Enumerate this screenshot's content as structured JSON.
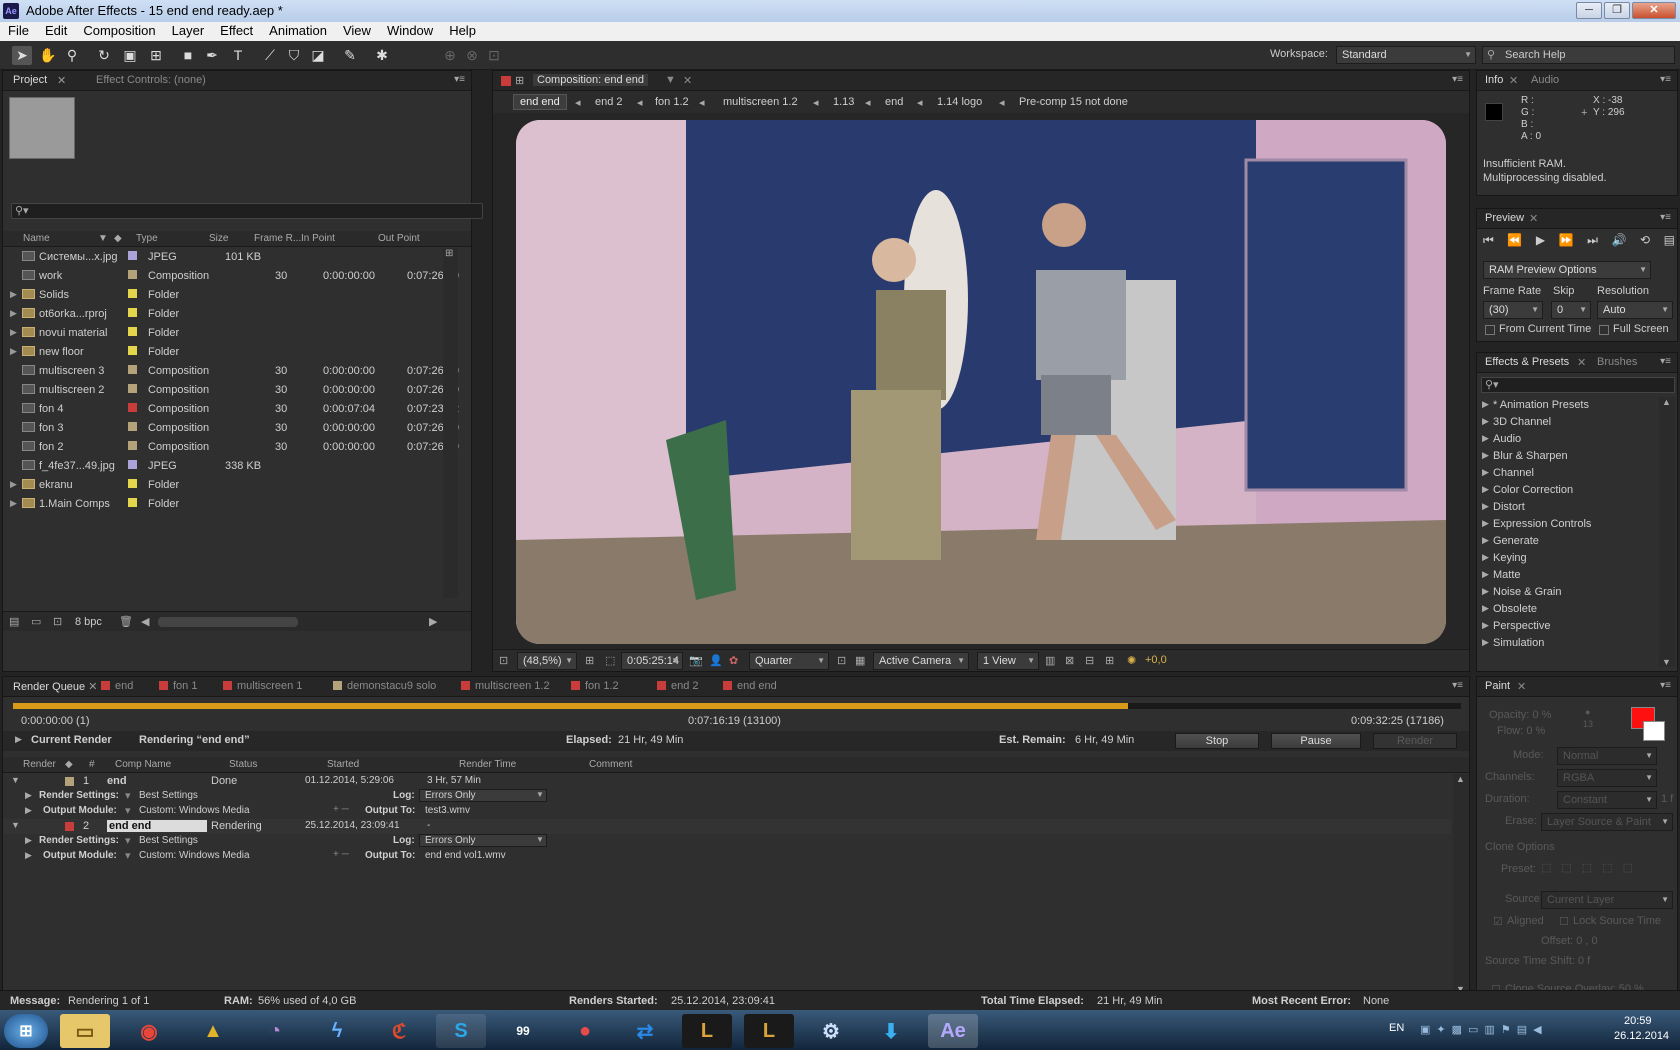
{
  "window": {
    "title": "Adobe After Effects - 15 end end ready.aep *",
    "app_icon": "Ae",
    "min": "─",
    "max": "❐",
    "close": "✕"
  },
  "menu": [
    "File",
    "Edit",
    "Composition",
    "Layer",
    "Effect",
    "Animation",
    "View",
    "Window",
    "Help"
  ],
  "toolbar": {
    "workspace_label": "Workspace:",
    "workspace_value": "Standard",
    "search_help": "Search Help"
  },
  "project": {
    "tabs": [
      "Project",
      "Effect Controls: (none)"
    ],
    "search_placeholder": "",
    "columns": [
      "Name",
      "Type",
      "Size",
      "Frame R...",
      "In Point",
      "Out Point"
    ],
    "items": [
      {
        "name": "Системы...x.jpg",
        "type": "JPEG",
        "size": "101 KB",
        "fr": "",
        "in": "",
        "out": "",
        "color": "#a9a3d9",
        "icon": "image-icon",
        "expand": false
      },
      {
        "name": "work",
        "type": "Composition",
        "size": "",
        "fr": "30",
        "in": "0:00:00:00",
        "out": "0:07:26:19",
        "color": "#b3a27a",
        "icon": "composition-icon",
        "expand": false
      },
      {
        "name": "Solids",
        "type": "Folder",
        "size": "",
        "fr": "",
        "in": "",
        "out": "",
        "color": "#e3d54c",
        "icon": "folder-icon",
        "expand": true
      },
      {
        "name": "ot6orka...rproj",
        "type": "Folder",
        "size": "",
        "fr": "",
        "in": "",
        "out": "",
        "color": "#e3d54c",
        "icon": "folder-icon",
        "expand": true
      },
      {
        "name": "novui material",
        "type": "Folder",
        "size": "",
        "fr": "",
        "in": "",
        "out": "",
        "color": "#e3d54c",
        "icon": "folder-icon",
        "expand": true
      },
      {
        "name": "new floor",
        "type": "Folder",
        "size": "",
        "fr": "",
        "in": "",
        "out": "",
        "color": "#e3d54c",
        "icon": "folder-icon",
        "expand": true
      },
      {
        "name": "multiscreen 3",
        "type": "Composition",
        "size": "",
        "fr": "30",
        "in": "0:00:00:00",
        "out": "0:07:26:19",
        "color": "#b3a27a",
        "icon": "composition-icon",
        "expand": false
      },
      {
        "name": "multiscreen 2",
        "type": "Composition",
        "size": "",
        "fr": "30",
        "in": "0:00:00:00",
        "out": "0:07:26:19",
        "color": "#b3a27a",
        "icon": "composition-icon",
        "expand": false
      },
      {
        "name": "fon 4",
        "type": "Composition",
        "size": "",
        "fr": "30",
        "in": "0:00:07:04",
        "out": "0:07:23:22",
        "color": "#c83c3c",
        "icon": "composition-icon",
        "expand": false
      },
      {
        "name": "fon 3",
        "type": "Composition",
        "size": "",
        "fr": "30",
        "in": "0:00:00:00",
        "out": "0:07:26:19",
        "color": "#b3a27a",
        "icon": "composition-icon",
        "expand": false
      },
      {
        "name": "fon 2",
        "type": "Composition",
        "size": "",
        "fr": "30",
        "in": "0:00:00:00",
        "out": "0:07:26:19",
        "color": "#b3a27a",
        "icon": "composition-icon",
        "expand": false
      },
      {
        "name": "f_4fe37...49.jpg",
        "type": "JPEG",
        "size": "338 KB",
        "fr": "",
        "in": "",
        "out": "",
        "color": "#a9a3d9",
        "icon": "image-icon",
        "expand": false
      },
      {
        "name": "ekranu",
        "type": "Folder",
        "size": "",
        "fr": "",
        "in": "",
        "out": "",
        "color": "#e3d54c",
        "icon": "folder-icon",
        "expand": true
      },
      {
        "name": "1.Main Comps",
        "type": "Folder",
        "size": "",
        "fr": "",
        "in": "",
        "out": "",
        "color": "#e3d54c",
        "icon": "folder-icon",
        "expand": true
      }
    ],
    "bpc": "8 bpc"
  },
  "composition": {
    "tab": "Composition: end end",
    "breadcrumbs": [
      "end end",
      "end 2",
      "fon 1.2",
      "multiscreen 1.2",
      "1.13",
      "end",
      "1.14 logo",
      "Pre-comp 15 not done"
    ],
    "zoom": "(48,5%)",
    "timecode": "0:05:25:14",
    "resolution": "Quarter",
    "camera": "Active Camera",
    "view": "1 View",
    "exposure": "+0,0"
  },
  "info": {
    "tabs": [
      "Info",
      "Audio"
    ],
    "r": "R :",
    "g": "G :",
    "b": "B :",
    "a": "A : 0",
    "x": "X : -38",
    "y": "Y : 296",
    "message": "Insufficient RAM.\nMultiprocessing disabled."
  },
  "preview": {
    "tab": "Preview",
    "ram_options": "RAM Preview Options",
    "frame_rate_label": "Frame Rate",
    "skip_label": "Skip",
    "resolution_label": "Resolution",
    "frame_rate": "(30)",
    "skip": "0",
    "resolution": "Auto",
    "from_current": "From Current Time",
    "full_screen": "Full Screen"
  },
  "effects": {
    "tabs": [
      "Effects & Presets",
      "Brushes"
    ],
    "items": [
      "* Animation Presets",
      "3D Channel",
      "Audio",
      "Blur & Sharpen",
      "Channel",
      "Color Correction",
      "Distort",
      "Expression Controls",
      "Generate",
      "Keying",
      "Matte",
      "Noise & Grain",
      "Obsolete",
      "Perspective",
      "Simulation"
    ]
  },
  "render": {
    "tabs": [
      {
        "label": "Render Queue",
        "color": ""
      },
      {
        "label": "end",
        "color": "#c83c3c"
      },
      {
        "label": "fon 1",
        "color": "#c83c3c"
      },
      {
        "label": "multiscreen 1",
        "color": "#c83c3c"
      },
      {
        "label": "demonstacu9 solo",
        "color": "#b3a27a"
      },
      {
        "label": "multiscreen 1.2",
        "color": "#c83c3c"
      },
      {
        "label": "fon 1.2",
        "color": "#c83c3c"
      },
      {
        "label": "end 2",
        "color": "#c83c3c"
      },
      {
        "label": "end end",
        "color": "#c83c3c"
      }
    ],
    "time_start": "0:00:00:00 (1)",
    "time_mid": "0:07:16:19 (13100)",
    "time_end": "0:09:32:25 (17186)",
    "progress": 0.77,
    "current_render_label": "Current Render",
    "rendering_text": "Rendering “end end”",
    "elapsed_label": "Elapsed:",
    "elapsed": "21 Hr, 49 Min",
    "remain_label": "Est. Remain:",
    "remain": "6 Hr, 49 Min",
    "stop": "Stop",
    "pause": "Pause",
    "render_btn": "Render",
    "columns": [
      "Render",
      "#",
      "Comp Name",
      "Status",
      "Started",
      "Render Time",
      "Comment"
    ],
    "items": [
      {
        "num": "1",
        "comp": "end",
        "status": "Done",
        "started": "01.12.2014, 5:29:06",
        "time": "3 Hr, 57 Min",
        "color": "#b3a27a",
        "settings": "Best Settings",
        "log": "Errors Only",
        "module": "Custom: Windows Media",
        "output": "test3.wmv"
      },
      {
        "num": "2",
        "comp": "end end",
        "status": "Rendering",
        "started": "25.12.2014, 23:09:41",
        "time": "-",
        "color": "#c83c3c",
        "settings": "Best Settings",
        "log": "Errors Only",
        "module": "Custom: Windows Media",
        "output": "end end vol1.wmv"
      }
    ],
    "settings_label": "Render Settings:",
    "log_label": "Log:",
    "module_label": "Output Module:",
    "output_label": "Output To:"
  },
  "status": {
    "message_label": "Message:",
    "message": "Rendering 1 of 1",
    "ram_label": "RAM:",
    "ram": "56% used of 4,0 GB",
    "started_label": "Renders Started:",
    "started": "25.12.2014, 23:09:41",
    "total_label": "Total Time Elapsed:",
    "total": "21 Hr, 49 Min",
    "error_label": "Most Recent Error:",
    "error": "None"
  },
  "paint": {
    "tab": "Paint",
    "opacity": "Opacity: 0 %",
    "flow": "Flow: 0 %",
    "mode_label": "Mode:",
    "mode": "Normal",
    "channels_label": "Channels:",
    "channels": "RGBA",
    "duration_label": "Duration:",
    "duration": "Constant",
    "duration_val": "1 f",
    "erase_label": "Erase:",
    "erase": "Layer Source & Paint",
    "clone_options": "Clone Options",
    "preset_label": "Preset:",
    "source_label": "Source:",
    "source": "Current Layer",
    "aligned": "Aligned",
    "lock_source": "Lock Source Time",
    "offset": "Offset: 0 , 0",
    "shift": "Source Time Shift: 0 f",
    "overlay": "Clone Source Overlay: 50 %",
    "size_val": "13"
  },
  "taskbar": {
    "lang": "EN",
    "time": "20:59",
    "date": "26.12.2014",
    "badge": "99"
  }
}
